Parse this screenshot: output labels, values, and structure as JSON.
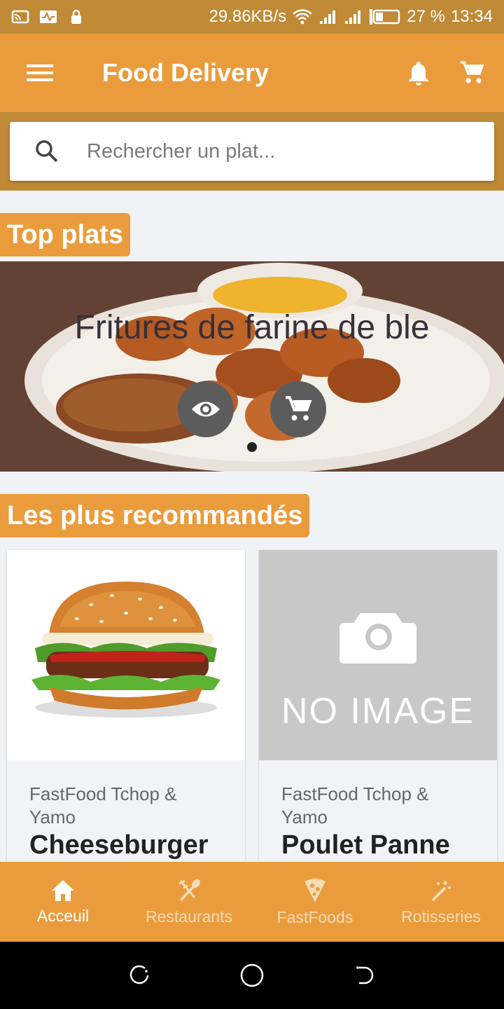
{
  "status_bar": {
    "network_speed": "29.86KB/s",
    "battery": "27 %",
    "time": "13:34"
  },
  "app_bar": {
    "title": "Food Delivery"
  },
  "search": {
    "placeholder": "Rechercher un plat..."
  },
  "sections": {
    "top_plats": "Top plats",
    "recommended": "Les plus recommandés"
  },
  "carousel": {
    "title": "Fritures de farine de ble",
    "page_count": 1,
    "current_page": 1
  },
  "cards": [
    {
      "restaurant": "FastFood Tchop & Yamo",
      "name": "Cheeseburger",
      "image": "burger"
    },
    {
      "restaurant": "FastFood Tchop & Yamo",
      "name": "Poulet Panne",
      "image": "NO IMAGE"
    }
  ],
  "bottom_nav": [
    {
      "label": "Acceuil",
      "icon": "home-icon",
      "active": true
    },
    {
      "label": "Restaurants",
      "icon": "fork-spoon-icon",
      "active": false
    },
    {
      "label": "FastFoods",
      "icon": "pizza-icon",
      "active": false
    },
    {
      "label": "Rotisseries",
      "icon": "magic-wand-icon",
      "active": false
    }
  ],
  "colors": {
    "primary": "#ea9c3c",
    "primary_dark": "#c08a36",
    "background": "#f1f2f6"
  }
}
